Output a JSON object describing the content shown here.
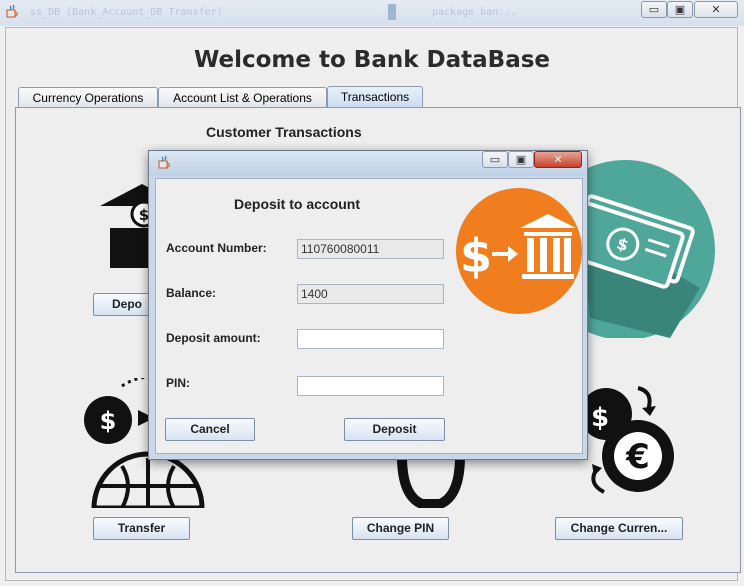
{
  "window": {
    "background_text_left": "ss_DB (Bank_Account_DB Transfer)",
    "background_text_right": "package ban..."
  },
  "main": {
    "title": "Welcome to Bank DataBase",
    "tabs": [
      {
        "label": "Currency Operations",
        "active": false
      },
      {
        "label": "Account List & Operations",
        "active": false
      },
      {
        "label": "Transactions",
        "active": true
      }
    ],
    "panel_title": "Customer Transactions",
    "buttons": {
      "deposit": "Depo",
      "transfer": "Transfer",
      "change_pin": "Change PIN",
      "change_currency": "Change Curren..."
    }
  },
  "dialog": {
    "heading": "Deposit to account",
    "account_number_label": "Account Number:",
    "account_number_value": "110760080011",
    "balance_label": "Balance:",
    "balance_value": "1400",
    "deposit_amount_label": "Deposit amount:",
    "deposit_amount_value": "",
    "pin_label": "PIN:",
    "pin_value": "",
    "cancel_label": "Cancel",
    "deposit_label": "Deposit"
  },
  "colors": {
    "accent_orange": "#f07d1e",
    "teal": "#4fa79a",
    "teal_dark": "#3a857a",
    "icon_black": "#111111"
  },
  "icons": [
    "java-cup-icon",
    "minimize-icon",
    "maximize-icon",
    "close-icon",
    "bank-deposit-icon",
    "cash-icon",
    "money-transfer-icon",
    "key-icon",
    "currency-exchange-icon"
  ]
}
